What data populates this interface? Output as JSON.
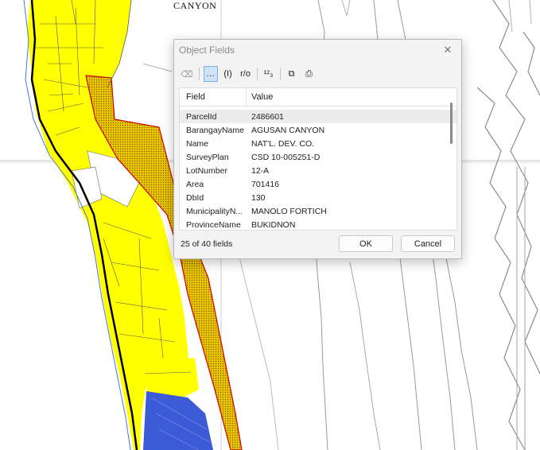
{
  "map": {
    "label": "CANYON"
  },
  "dialog": {
    "title": "Object Fields",
    "close_glyph": "✕",
    "toolbar": {
      "tools": [
        {
          "label": "⌫",
          "icon": "clear-icon"
        },
        {
          "label": "…",
          "icon": "ellipsis-icon"
        },
        {
          "label": "(I)",
          "icon": "identify-icon"
        },
        {
          "label": "r/o",
          "icon": "readonly-icon"
        },
        {
          "label": "¹²₃",
          "icon": "numeric-icon"
        },
        {
          "label": "⧉",
          "icon": "copy-icon"
        },
        {
          "label": "⎙",
          "icon": "print-icon"
        }
      ]
    },
    "table": {
      "headers": {
        "field": "Field",
        "value": "Value"
      },
      "rows": [
        {
          "field": "ParcelId",
          "value": "2486601"
        },
        {
          "field": "BarangayName",
          "value": "AGUSAN CANYON"
        },
        {
          "field": "Name",
          "value": "NAT'L. DEV. CO."
        },
        {
          "field": "SurveyPlan",
          "value": "CSD 10-005251-D"
        },
        {
          "field": "LotNumber",
          "value": "12-A"
        },
        {
          "field": "Area",
          "value": "701416"
        },
        {
          "field": "DbId",
          "value": "130"
        },
        {
          "field": "MunicipalityN...",
          "value": "MANOLO FORTICH"
        },
        {
          "field": "ProvinceName",
          "value": "BUKIDNON"
        }
      ]
    },
    "field_count": "25 of 40 fields",
    "ok_label": "OK",
    "cancel_label": "Cancel"
  }
}
